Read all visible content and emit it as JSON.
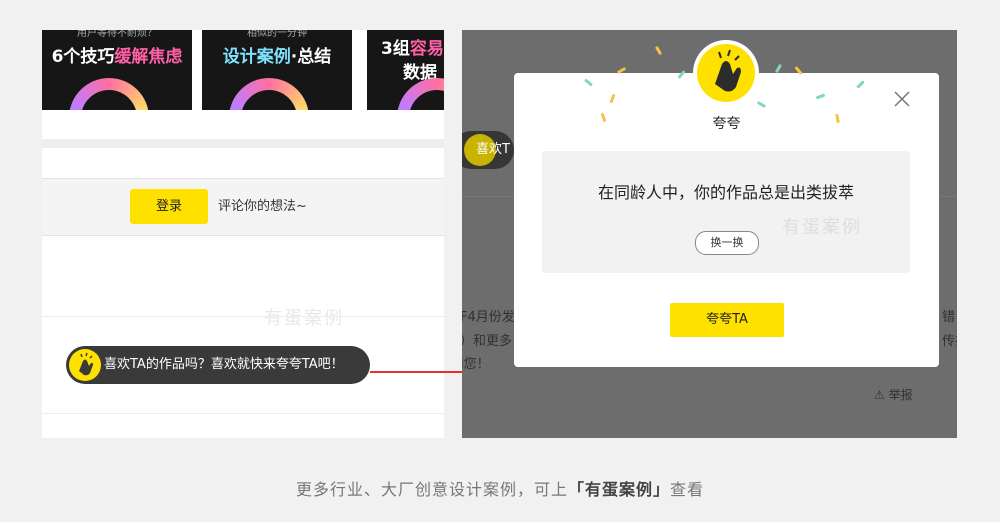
{
  "left": {
    "thumbnails": [
      {
        "top": "用户等待不耐烦？",
        "caption_a": "6个技巧",
        "caption_b": "缓解焦虑",
        "accent": "#ff5fa8"
      },
      {
        "top": "相似的一分钟",
        "caption_a": "设计案例",
        "caption_b": "·总结",
        "accent": "#ffffff"
      },
      {
        "top": "",
        "caption_a": "3组",
        "caption_b": "容易",
        "caption_c": "数据"
      }
    ],
    "login_label": "登录",
    "comment_hint": "评论你的想法~",
    "watermark": "有蛋案例",
    "like_prompt": "喜欢TA的作品吗？喜欢就快来夸夸TA吧！"
  },
  "right": {
    "bg_pill": "喜欢T",
    "bg_line1": "F4月份发",
    "bg_line2": "）和更多",
    "bg_line3": "i您！",
    "bg_right1": "错",
    "bg_right2": "传插",
    "report": "举报",
    "modal": {
      "title": "夸夸",
      "quote": "在同龄人中，你的作品总是出类拔萃",
      "swap_label": "换一换",
      "praise_label": "夸夸TA",
      "watermark": "有蛋案例"
    }
  },
  "caption": {
    "prefix": "更多行业、大厂创意设计案例，可上",
    "brand": "「有蛋案例」",
    "suffix": "查看"
  },
  "colors": {
    "accent_yellow": "#ffe100",
    "arrow_red": "#e53030",
    "overlay_grey": "#6d6d6d"
  }
}
